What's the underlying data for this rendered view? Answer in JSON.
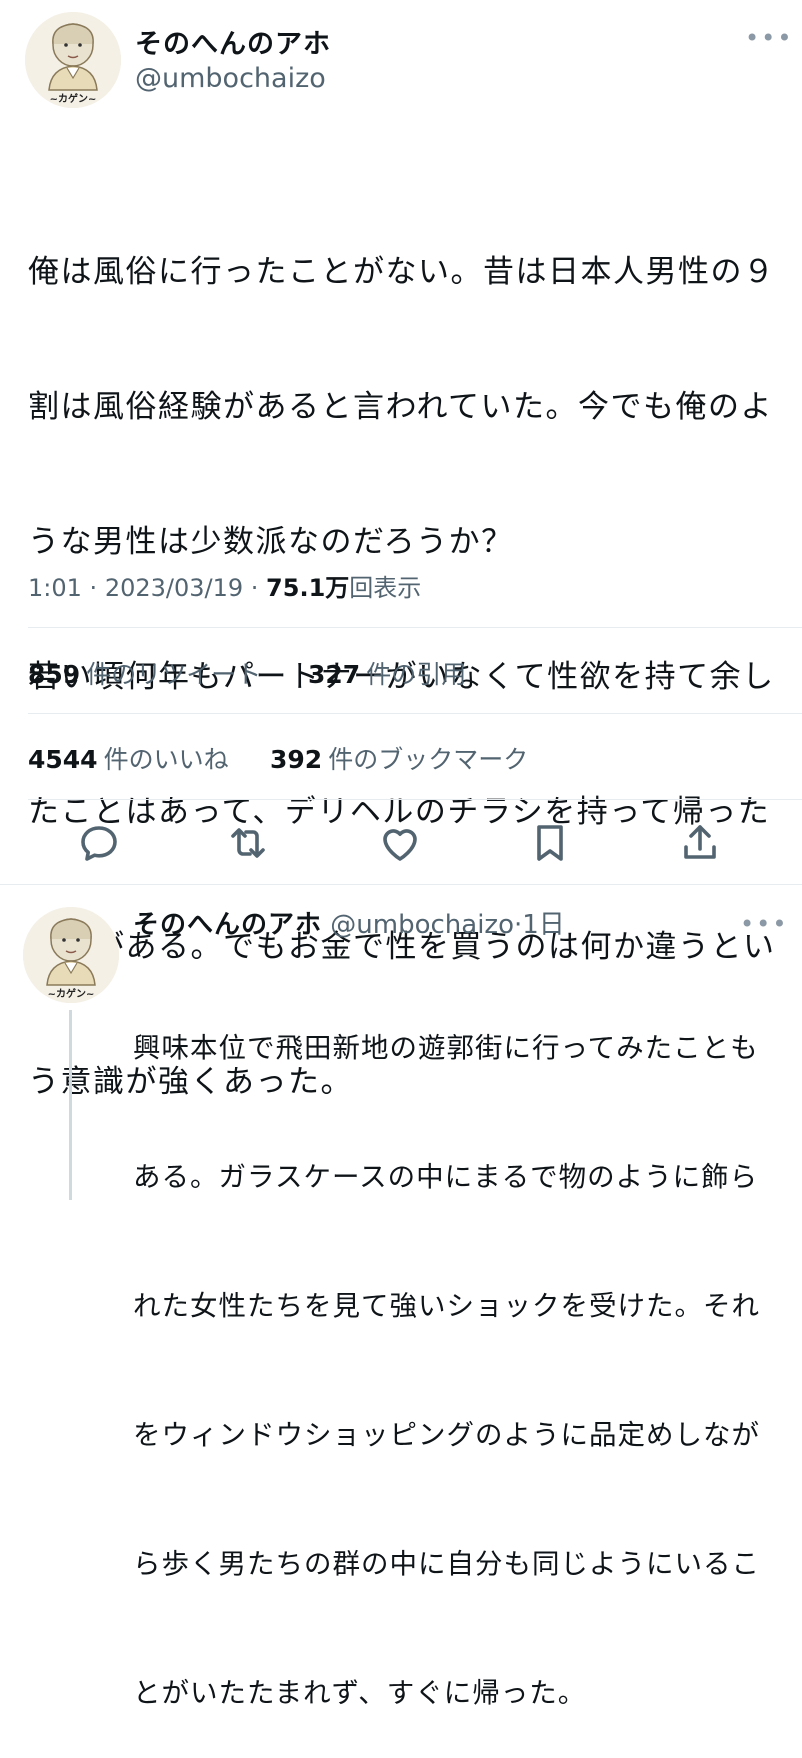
{
  "tweet": {
    "author_name": "そのへんのアホ",
    "author_handle": "@umbochaizo",
    "avatar_caption": "~カゲン~",
    "text_lines": [
      "俺は風俗に行ったことがない。昔は日本人男性の９",
      "割は風俗経験があると言われていた。今でも俺のよ",
      "うな男性は少数派なのだろうか？",
      "若い頃何年もパートナーがいなくて性欲を持て余し",
      "たことはあって、デリヘルのチラシを持って帰った",
      "ことがある。でもお金で性を買うのは何か違うとい",
      "う意識が強くあった。"
    ],
    "time": "1:01",
    "date": "2023/03/19",
    "views_num": "75.1万",
    "views_label": "回表示",
    "more_icon": "more-dots-icon"
  },
  "stats": {
    "retweets_num": "859",
    "retweets_label": "件のリツイート",
    "quotes_num": "327",
    "quotes_label": "件の引用",
    "likes_num": "4544",
    "likes_label": "件のいいね",
    "bookmarks_num": "392",
    "bookmarks_label": "件のブックマーク"
  },
  "actions": [
    "reply-icon",
    "retweet-icon",
    "like-icon",
    "bookmark-icon",
    "share-icon"
  ],
  "reply": {
    "author_name": "そのへんのアホ",
    "author_handle": "@umbochaizo",
    "age": "1日",
    "avatar_caption": "~カゲン~",
    "text_lines": [
      "興味本位で飛田新地の遊郭街に行ってみたことも",
      "ある。ガラスケースの中にまるで物のように飾ら",
      "れた女性たちを見て強いショックを受けた。それ",
      "をウィンドウショッピングのように品定めしなが",
      "ら歩く男たちの群の中に自分も同じようにいるこ",
      "とがいたたまれず、すぐに帰った。"
    ]
  },
  "colors": {
    "text": "#0f1419",
    "secondary": "#536471",
    "divider": "#e6ecf0",
    "icon": "#536471"
  }
}
